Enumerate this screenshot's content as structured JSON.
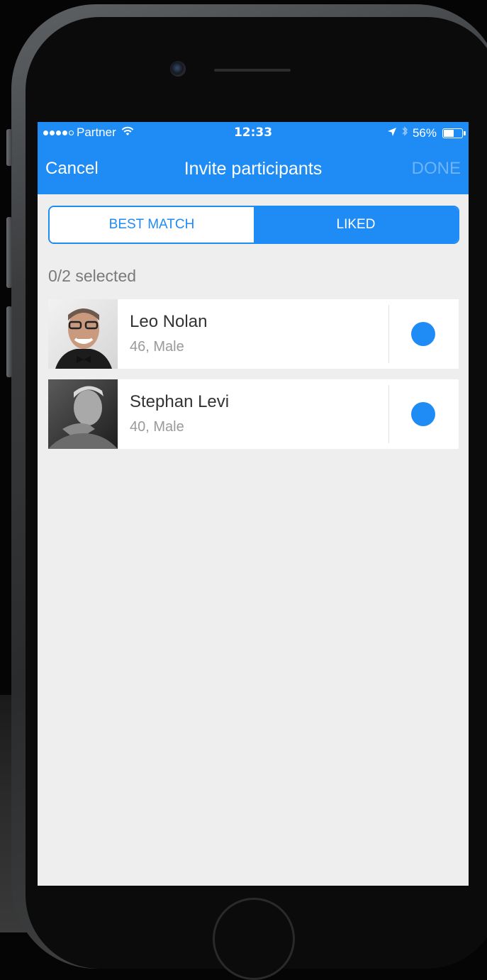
{
  "status_bar": {
    "carrier": "Partner",
    "time": "12:33",
    "battery": "56%",
    "battery_level": 0.56
  },
  "nav": {
    "cancel_label": "Cancel",
    "title": "Invite participants",
    "done_label": "DONE"
  },
  "tabs": [
    {
      "label": "BEST MATCH",
      "active": false
    },
    {
      "label": "LIKED",
      "active": true
    }
  ],
  "selection_count": "0/2 selected",
  "participants": [
    {
      "name": "Leo Nolan",
      "meta": "46, Male"
    },
    {
      "name": "Stephan Levi",
      "meta": "40, Male"
    }
  ],
  "colors": {
    "accent": "#1f8bf4",
    "background": "#eeeeee",
    "done_disabled": "#6fb4f8"
  },
  "icons": [
    "signal-dots-icon",
    "wifi-icon",
    "location-arrow-icon",
    "bluetooth-icon",
    "battery-icon",
    "camera-icon",
    "home-button-icon"
  ]
}
